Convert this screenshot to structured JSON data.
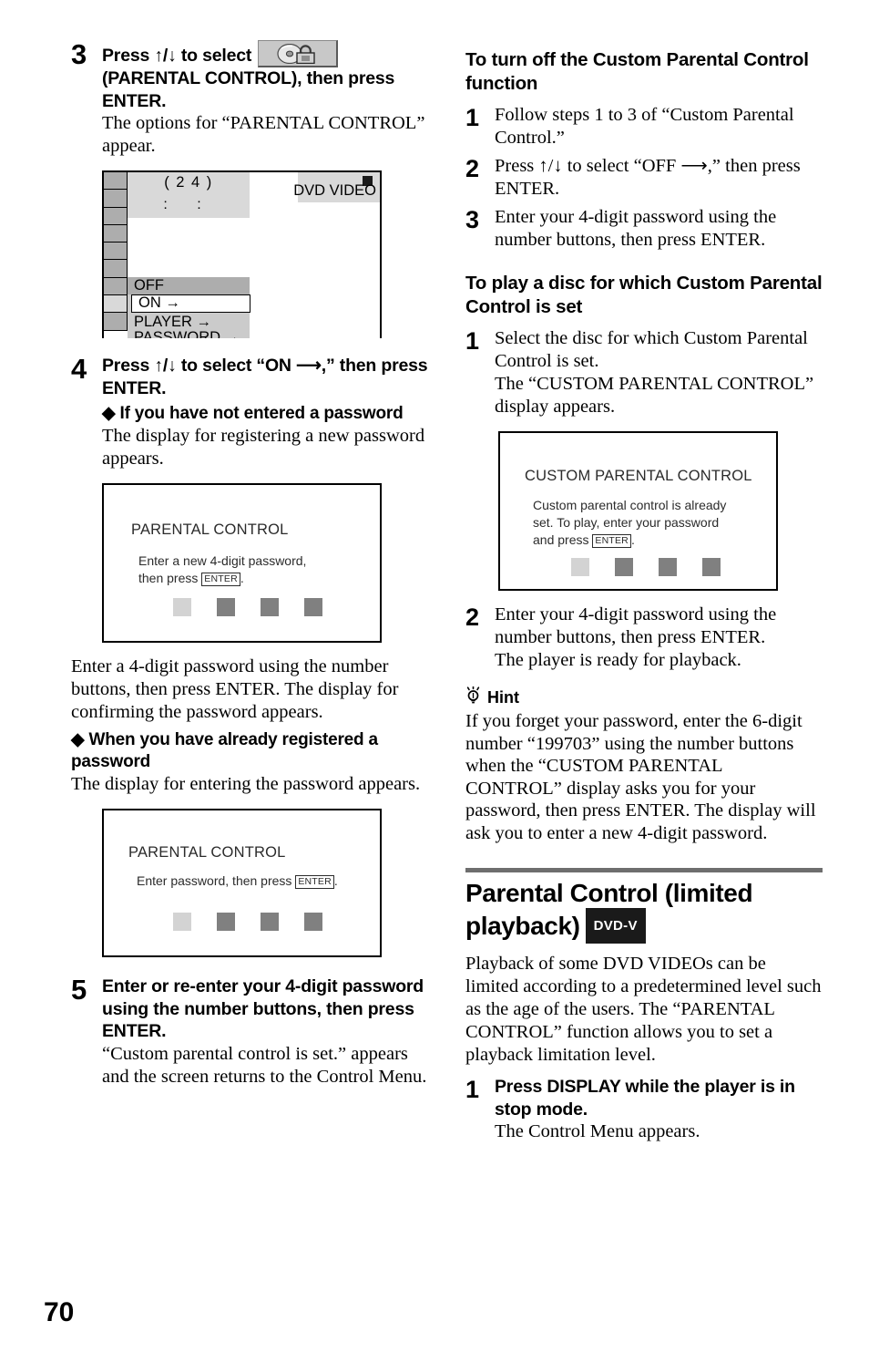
{
  "page": {
    "number": "70"
  },
  "left_column": {
    "step3": {
      "number": "3",
      "head_before": "Press ↑/↓ to select",
      "icon_name": "parental-control-icon",
      "head_after": "(PARENTAL CONTROL), then press ENTER.",
      "body": "The options for “PARENTAL CONTROL” appear."
    },
    "control_menu_screen": {
      "title_number": "( 2 4 )",
      "time_display": ":  :",
      "disc_label": "DVD VIDEO",
      "stop_icon": "stop-square-icon",
      "options": [
        {
          "label": "OFF",
          "selected": false,
          "highlighted": true
        },
        {
          "label": "ON →",
          "selected": true,
          "highlighted": false
        },
        {
          "label": "PLAYER →",
          "selected": false,
          "highlighted": false
        },
        {
          "label": "PASSWORD →",
          "selected": false,
          "highlighted": false
        }
      ],
      "sidebar_cell_count": 9,
      "sidebar_selected_index": 7
    },
    "step4": {
      "number": "4",
      "head": "Press ↑/↓ to select “ON ⟶,” then press ENTER.",
      "sub1_head": "◆ If you have not entered a password",
      "sub1_body": "The display for registering a new password appears."
    },
    "osd_new_password": {
      "title": "PARENTAL CONTROL",
      "line1": "Enter a new 4-digit password,",
      "line2_before": "then press ",
      "enter_key": "ENTER",
      "line2_after": ".",
      "password_boxes": [
        "#d3d3d3",
        "#808080",
        "#808080",
        "#808080"
      ]
    },
    "after_osd1_body": "Enter a 4-digit password using the number buttons, then press ENTER. The display for confirming the password appears.",
    "sub2_head": "◆ When you have already registered a password",
    "sub2_body": "The display for entering the password appears.",
    "osd_enter_password": {
      "title": "PARENTAL CONTROL",
      "line1_before": "Enter password, then press ",
      "enter_key": "ENTER",
      "line1_after": ".",
      "password_boxes": [
        "#d3d3d3",
        "#808080",
        "#808080",
        "#808080"
      ]
    },
    "step5": {
      "number": "5",
      "head": "Enter or re-enter your 4-digit password using the number buttons, then press ENTER.",
      "body": "“Custom parental control is set.” appears and the screen returns to the Control Menu."
    }
  },
  "right_column": {
    "section1": {
      "heading": "To turn off the Custom Parental Control function",
      "steps": [
        {
          "number": "1",
          "text": "Follow steps 1 to 3 of “Custom Parental Control.”"
        },
        {
          "number": "2",
          "text": "Press ↑/↓ to select “OFF ⟶,” then press ENTER."
        },
        {
          "number": "3",
          "text": "Enter your 4-digit password using the number buttons, then press ENTER."
        }
      ]
    },
    "section2": {
      "heading": "To play a disc for which Custom Parental Control is set",
      "step1": {
        "number": "1",
        "text": "Select the disc for which Custom Parental Control is set.",
        "text2": "The “CUSTOM PARENTAL CONTROL” display appears."
      },
      "osd_custom": {
        "title": "CUSTOM PARENTAL CONTROL",
        "line1": "Custom parental control is already",
        "line2": "set. To play, enter your password",
        "line3_before": "and press ",
        "enter_key": "ENTER",
        "line3_after": ".",
        "password_boxes": [
          "#d3d3d3",
          "#808080",
          "#808080",
          "#808080"
        ]
      },
      "step2": {
        "number": "2",
        "text": "Enter your 4-digit password using the number buttons, then press ENTER.",
        "text2": "The player is ready for playback."
      }
    },
    "hint": {
      "icon_name": "lightbulb-icon",
      "label": "Hint",
      "body": "If you forget your password, enter the 6-digit number “199703” using the number buttons when the “CUSTOM PARENTAL CONTROL” display asks you for your password, then press ENTER. The display will ask you to enter a new 4-digit password."
    },
    "section3": {
      "heading": "Parental Control (limited playback)",
      "badge": "DVD-V",
      "body": "Playback of some DVD VIDEOs can be limited according to a predetermined level such as the age of the users. The “PARENTAL CONTROL” function allows you to set a playback limitation level.",
      "step1": {
        "number": "1",
        "head": "Press DISPLAY while the player is in stop mode.",
        "body": "The Control Menu appears."
      }
    }
  }
}
